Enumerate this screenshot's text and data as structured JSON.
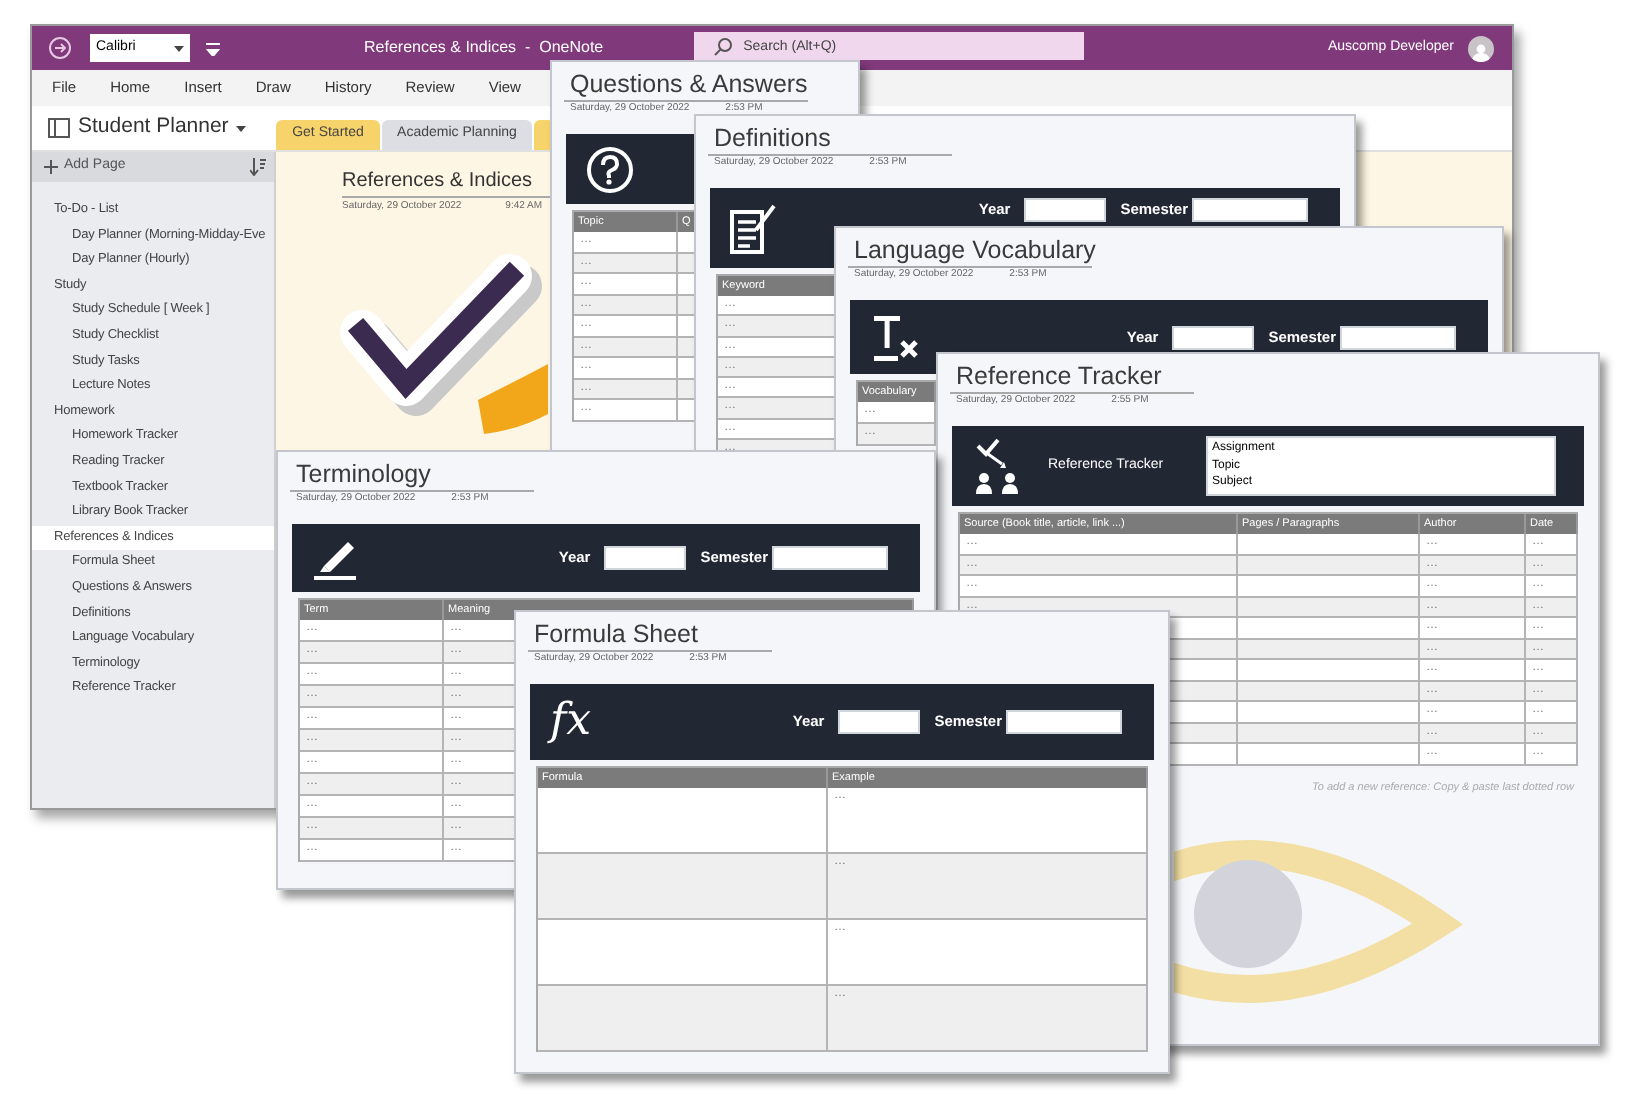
{
  "window": {
    "font_box": "Calibri",
    "title": "References & Indices  -  OneNote",
    "search": {
      "placeholder": "Search (Alt+Q)"
    },
    "user": "Auscomp Developer"
  },
  "menu": [
    "File",
    "Home",
    "Insert",
    "Draw",
    "History",
    "Review",
    "View"
  ],
  "notebook": {
    "name": "Student Planner",
    "section_tabs": [
      {
        "label": "Get Started",
        "color": "#f6d36b"
      },
      {
        "label": "Academic Planning",
        "color": "#dcdee3"
      },
      {
        "color": "#f6d36b"
      }
    ]
  },
  "sidebar": {
    "add_page": "Add Page",
    "pages": [
      {
        "label": "To-Do - List",
        "selected": false,
        "children": [
          {
            "label": "Day Planner (Morning-Midday-Eve",
            "selected": false
          },
          {
            "label": "Day Planner (Hourly)",
            "selected": false
          }
        ]
      },
      {
        "label": "Study",
        "selected": false,
        "children": [
          {
            "label": "Study Schedule [ Week ]",
            "selected": false
          },
          {
            "label": "Study Checklist",
            "selected": false
          },
          {
            "label": "Study Tasks",
            "selected": false
          },
          {
            "label": "Lecture Notes",
            "selected": false
          }
        ]
      },
      {
        "label": "Homework",
        "selected": false,
        "children": [
          {
            "label": "Homework Tracker",
            "selected": false
          },
          {
            "label": "Reading Tracker",
            "selected": false
          },
          {
            "label": "Textbook Tracker",
            "selected": false
          },
          {
            "label": "Library Book Tracker",
            "selected": false
          }
        ]
      },
      {
        "label": "References & Indices",
        "selected": true,
        "children": [
          {
            "label": "Formula Sheet",
            "selected": false
          },
          {
            "label": "Questions & Answers",
            "selected": false
          },
          {
            "label": "Definitions",
            "selected": false
          },
          {
            "label": "Language Vocabulary",
            "selected": false
          },
          {
            "label": "Terminology",
            "selected": false
          },
          {
            "label": "Reference Tracker",
            "selected": false
          }
        ]
      }
    ]
  },
  "page": {
    "title": "References & Indices",
    "date": "Saturday, 29 October 2022",
    "time": "9:42 AM"
  },
  "cards": [
    {
      "kind": "qa",
      "title": "Questions & Answers",
      "date": "Saturday, 29 October 2022",
      "time": "2:53 PM",
      "columns": [
        "Topic",
        "Q"
      ],
      "rows": [
        [
          "…"
        ],
        [
          "…"
        ],
        [
          "…"
        ],
        [
          "…"
        ],
        [
          "…"
        ],
        [
          "…"
        ],
        [
          "…"
        ],
        [
          "…"
        ],
        [
          "…"
        ]
      ]
    },
    {
      "kind": "definitions",
      "title": "Definitions",
      "date": "Saturday, 29 October 2022",
      "time": "2:53 PM",
      "header": {
        "year_label": "Year",
        "semester_label": "Semester"
      },
      "columns": [
        "Keyword"
      ],
      "rows": [
        [
          "…"
        ],
        [
          "…"
        ],
        [
          "…"
        ],
        [
          "…"
        ],
        [
          "…"
        ],
        [
          "…"
        ],
        [
          "…"
        ],
        [
          "…"
        ]
      ]
    },
    {
      "kind": "vocabulary",
      "title": "Language Vocabulary",
      "date": "Saturday, 29 October 2022",
      "time": "2:53 PM",
      "header": {
        "year_label": "Year",
        "semester_label": "Semester"
      },
      "columns": [
        "Vocabulary"
      ],
      "rows": [
        [
          "…"
        ],
        [
          "…"
        ]
      ]
    },
    {
      "kind": "reference",
      "title": "Reference Tracker",
      "date": "Saturday, 29 October 2022",
      "time": "2:55 PM",
      "header": {
        "label": "Reference Tracker",
        "fields": [
          "Assignment",
          "Topic",
          "Subject"
        ]
      },
      "columns": [
        "Source (Book title, article, link ...)",
        "Pages / Paragraphs",
        "Author",
        "Date"
      ],
      "rows": [
        [
          "…",
          null,
          "…",
          "…"
        ],
        [
          "…",
          null,
          "…",
          "…"
        ],
        [
          "…",
          null,
          "…",
          "…"
        ],
        [
          "…",
          null,
          "…",
          "…"
        ],
        [
          null,
          null,
          "…",
          "…"
        ],
        [
          null,
          null,
          "…",
          "…"
        ],
        [
          null,
          null,
          "…",
          "…"
        ],
        [
          null,
          null,
          "…",
          "…"
        ],
        [
          null,
          null,
          "…",
          "…"
        ],
        [
          null,
          null,
          "…",
          "…"
        ],
        [
          null,
          null,
          "…",
          "…"
        ]
      ],
      "note": "To add a new reference: Copy & paste last dotted row"
    },
    {
      "kind": "terminology",
      "title": "Terminology",
      "date": "Saturday, 29 October 2022",
      "time": "2:53 PM",
      "header": {
        "year_label": "Year",
        "semester_label": "Semester"
      },
      "columns": [
        "Term",
        "Meaning"
      ],
      "rows": [
        [
          "…",
          "…"
        ],
        [
          "…",
          "…"
        ],
        [
          "…",
          "…"
        ],
        [
          "…",
          "…"
        ],
        [
          "…",
          "…"
        ],
        [
          "…",
          "…"
        ],
        [
          "…",
          "…"
        ],
        [
          "…",
          "…"
        ],
        [
          "…",
          "…"
        ],
        [
          "…",
          "…"
        ],
        [
          "…",
          "…"
        ]
      ]
    },
    {
      "kind": "formula",
      "title": "Formula Sheet",
      "date": "Saturday, 29 October 2022",
      "time": "2:53 PM",
      "header": {
        "icon_text": "fx",
        "year_label": "Year",
        "semester_label": "Semester"
      },
      "columns": [
        "Formula",
        "Example"
      ],
      "rows": [
        [
          null,
          "…"
        ],
        [
          null,
          "…"
        ],
        [
          null,
          "…"
        ],
        [
          null,
          "…"
        ]
      ]
    }
  ]
}
